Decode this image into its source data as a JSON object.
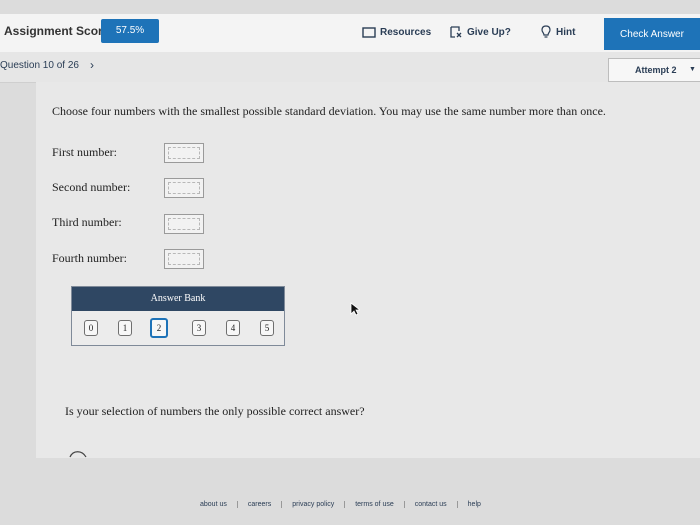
{
  "header": {
    "score_label": "Assignment Score:",
    "score_value": "57.5%",
    "resources_label": "Resources",
    "giveup_label": "Give Up?",
    "hint_label": "Hint",
    "check_label": "Check Answer",
    "accent_color": "#1e73b8"
  },
  "question_bar": {
    "question_label": "Question 10 of 26",
    "next_icon": "chevron-right-icon",
    "attempt_label": "Attempt 2"
  },
  "content": {
    "prompt": "Choose four numbers with the smallest possible standard deviation. You may use the same number more than once.",
    "fields": [
      {
        "label": "First number:"
      },
      {
        "label": "Second number:"
      },
      {
        "label": "Third number:"
      },
      {
        "label": "Fourth number:"
      }
    ],
    "answer_bank": {
      "title": "Answer Bank",
      "items": [
        "0",
        "1",
        "2",
        "3",
        "4",
        "5"
      ],
      "selected": "2"
    },
    "followup": "Is your selection of numbers the only possible correct answer?"
  },
  "footer": {
    "links": [
      "about us",
      "careers",
      "privacy policy",
      "terms of use",
      "contact us",
      "help"
    ]
  }
}
